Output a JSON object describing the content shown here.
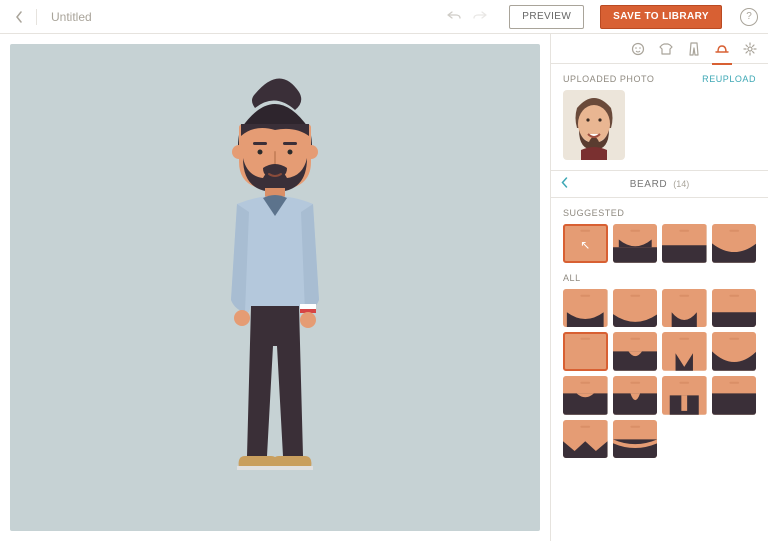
{
  "header": {
    "title": "Untitled",
    "preview_label": "PREVIEW",
    "save_label": "SAVE TO LIBRARY"
  },
  "tabs": [
    {
      "icon": "face-icon",
      "active": false
    },
    {
      "icon": "shirt-icon",
      "active": false
    },
    {
      "icon": "pants-icon",
      "active": false
    },
    {
      "icon": "hat-icon",
      "active": true
    },
    {
      "icon": "gear-icon",
      "active": false
    }
  ],
  "panel": {
    "uploaded_label": "UPLOADED PHOTO",
    "reupload_label": "REUPLOAD",
    "category_title": "BEARD",
    "category_count": "(14)",
    "suggested_label": "SUGGESTED",
    "all_label": "ALL",
    "suggested": [
      {
        "style": 0,
        "selected": true
      },
      {
        "style": 1
      },
      {
        "style": 2
      },
      {
        "style": 3
      }
    ],
    "all": [
      {
        "style": 4
      },
      {
        "style": 5
      },
      {
        "style": 6
      },
      {
        "style": 7
      },
      {
        "style": 0,
        "selected": true
      },
      {
        "style": 8
      },
      {
        "style": 9
      },
      {
        "style": 10
      },
      {
        "style": 11
      },
      {
        "style": 12
      },
      {
        "style": 13
      },
      {
        "style": 14
      },
      {
        "style": 15
      },
      {
        "style": 16
      }
    ]
  },
  "colors": {
    "accent": "#d86033",
    "canvas": "#c6d2d4",
    "skin": "#e59c74",
    "hair": "#3a2f38"
  }
}
